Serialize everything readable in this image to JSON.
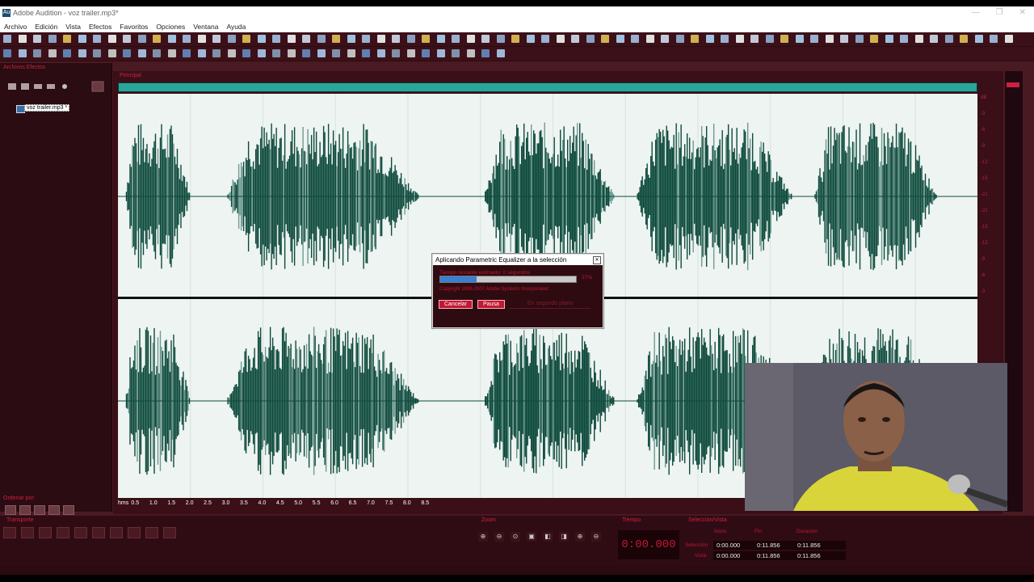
{
  "window": {
    "title": "Adobe Audition - voz trailer.mp3*",
    "minimize": "—",
    "maximize": "❐",
    "close": "✕"
  },
  "menu": [
    "Archivo",
    "Edición",
    "Vista",
    "Efectos",
    "Favoritos",
    "Opciones",
    "Ventana",
    "Ayuda"
  ],
  "left_panel": {
    "tab": "Archivos  Efectos",
    "file": "voz trailer.mp3 *",
    "sort_label": "Ordenar por:"
  },
  "editor": {
    "tab": "Principal",
    "time_labels": [
      "hms",
      "0.5",
      "1.0",
      "1.5",
      "2.0",
      "2.5",
      "3.0",
      "3.5",
      "4.0",
      "4.5",
      "5.0",
      "5.5",
      "6.0",
      "6.5",
      "7.0",
      "7.5",
      "8.0",
      "8.5"
    ],
    "db_labels": [
      "dB",
      "-3",
      "-6",
      "-9",
      "-12",
      "-15",
      "-21",
      "-21",
      "-15",
      "-12",
      "-9",
      "-6",
      "-3"
    ]
  },
  "dialog": {
    "title": "Aplicando Parametric Equalizer a la selección",
    "line1": "Tiempo restante estimado: 0 segundos",
    "progress": 0.27,
    "pct": "27%",
    "line2": "Copyright 1995-2007 Adobe Systems Incorporated",
    "cancel": "Cancelar",
    "pause": "Pausa",
    "background": "En segundo plano"
  },
  "bottom": {
    "transport_label": "Transporte",
    "zoom_label": "Zoom",
    "time_label": "Tiempo",
    "time_value": "0:00.000",
    "selection_label": "Selección/Vista",
    "columns": [
      "Inicio",
      "Fin",
      "Duración"
    ],
    "rows": [
      {
        "label": "Selección",
        "start": "0:00.000",
        "end": "0:11.856",
        "dur": "0:11.856"
      },
      {
        "label": "Vista",
        "start": "0:00.000",
        "end": "0:11.856",
        "dur": "0:11.856"
      }
    ]
  },
  "colors": {
    "waveform": "#0d4a3c",
    "waveform_light": "#6f9a90",
    "accent": "#c01835",
    "panel": "#3a0f17"
  }
}
